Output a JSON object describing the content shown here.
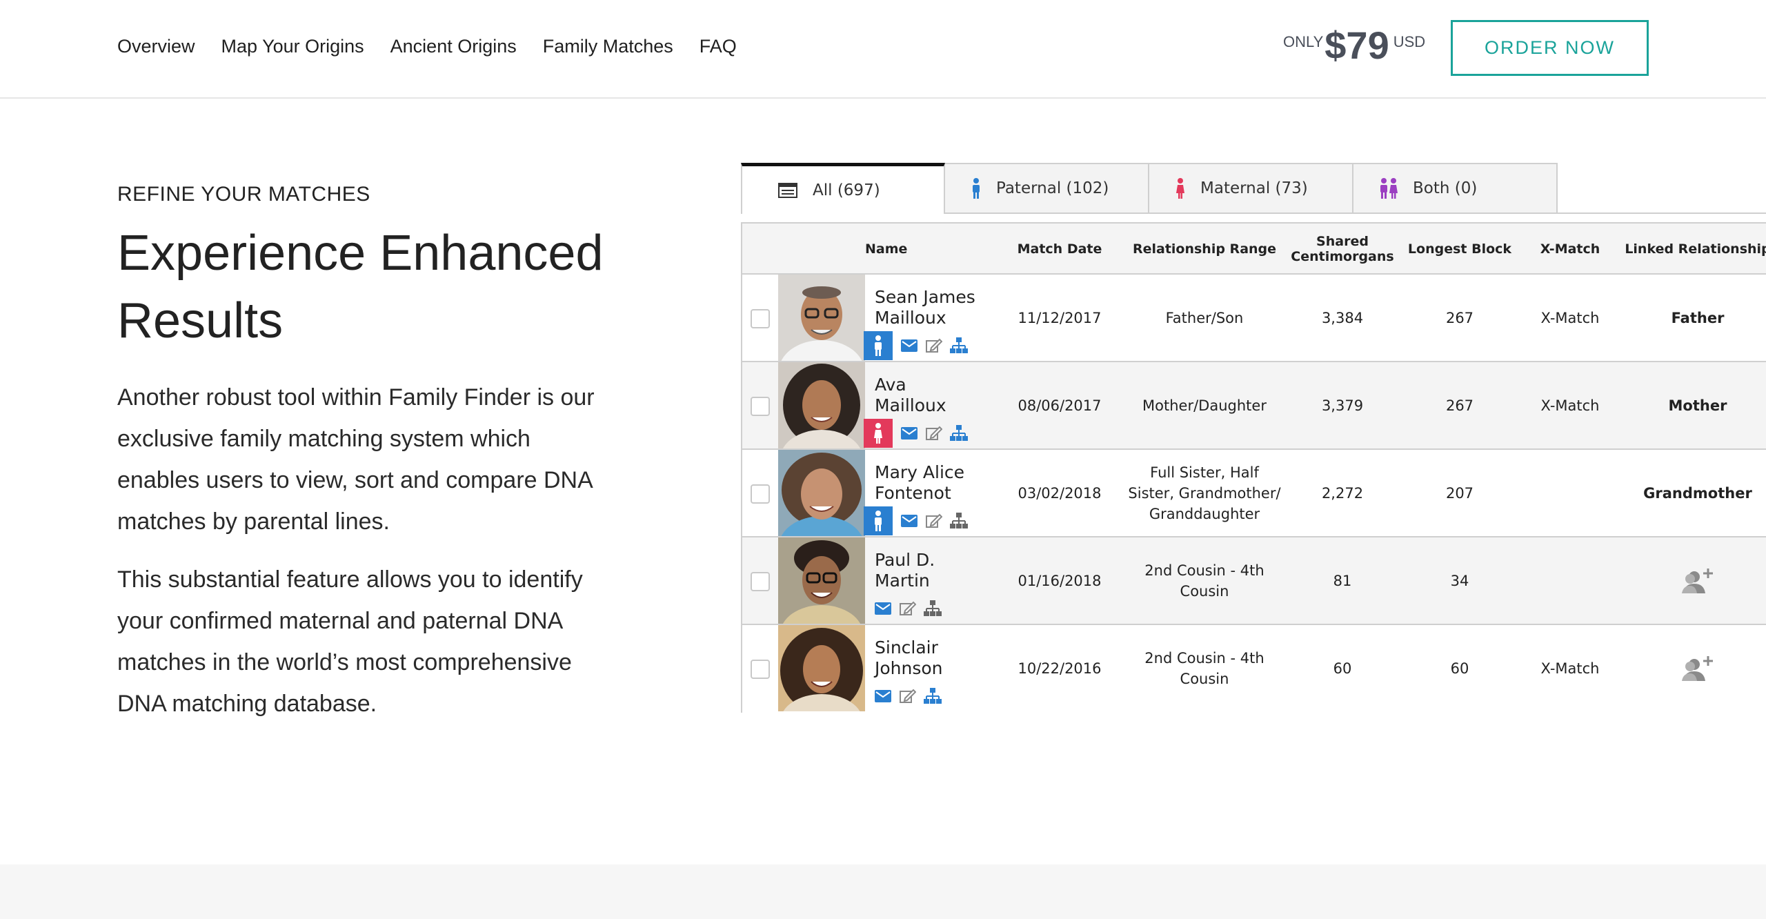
{
  "nav": {
    "items": [
      "Overview",
      "Map Your Origins",
      "Ancient Origins",
      "Family Matches",
      "FAQ"
    ]
  },
  "price": {
    "prefix": "ONLY",
    "amount": "$79",
    "currency": "USD"
  },
  "cta": {
    "label": "ORDER NOW"
  },
  "colors": {
    "accent": "#1aa39a",
    "paternal": "#2a7fd0",
    "maternal": "#e3395b",
    "both": "#9b3fc1"
  },
  "content": {
    "eyebrow": "REFINE YOUR MATCHES",
    "headline": "Experience Enhanced Results",
    "paragraph1": "Another robust tool within Family Finder is our exclusive family matching system which enables users to view, sort and compare DNA matches by parental lines.",
    "paragraph2": "This substantial feature allows you to identify your confirmed maternal and paternal DNA matches in the world’s most comprehensive DNA matching database."
  },
  "matches": {
    "tabs": [
      {
        "label": "All (697)",
        "icon": "list-icon"
      },
      {
        "label": "Paternal (102)",
        "icon": "male-icon"
      },
      {
        "label": "Maternal (73)",
        "icon": "female-icon"
      },
      {
        "label": "Both (0)",
        "icon": "couple-icon"
      }
    ],
    "columns": {
      "name": "Name",
      "match_date": "Match Date",
      "relationship_range": "Relationship Range",
      "shared_cm": "Shared Centimorgans",
      "longest_block": "Longest Block",
      "x_match": "X-Match",
      "linked_relationship": "Linked Relationship"
    },
    "rows": [
      {
        "name": "Sean James Mailloux",
        "badge": "paternal",
        "match_date": "11/12/2017",
        "relationship_range": "Father/Son",
        "shared_cm": "3,384",
        "longest_block": "267",
        "x_match": "X-Match",
        "linked_relationship": "Father"
      },
      {
        "name": "Ava Mailloux",
        "badge": "maternal",
        "match_date": "08/06/2017",
        "relationship_range": "Mother/Daughter",
        "shared_cm": "3,379",
        "longest_block": "267",
        "x_match": "X-Match",
        "linked_relationship": "Mother"
      },
      {
        "name": "Mary Alice Fontenot",
        "badge": "paternal",
        "match_date": "03/02/2018",
        "relationship_range": "Full Sister, Half Sister, Grandmother/ Granddaughter",
        "shared_cm": "2,272",
        "longest_block": "207",
        "x_match": "",
        "linked_relationship": "Grandmother"
      },
      {
        "name": "Paul D. Martin",
        "badge": "",
        "match_date": "01/16/2018",
        "relationship_range": "2nd Cousin - 4th Cousin",
        "shared_cm": "81",
        "longest_block": "34",
        "x_match": "",
        "linked_relationship": ""
      },
      {
        "name": "Sinclair Johnson",
        "badge": "",
        "match_date": "10/22/2016",
        "relationship_range": "2nd Cousin - 4th Cousin",
        "shared_cm": "60",
        "longest_block": "60",
        "x_match": "X-Match",
        "linked_relationship": ""
      }
    ]
  }
}
